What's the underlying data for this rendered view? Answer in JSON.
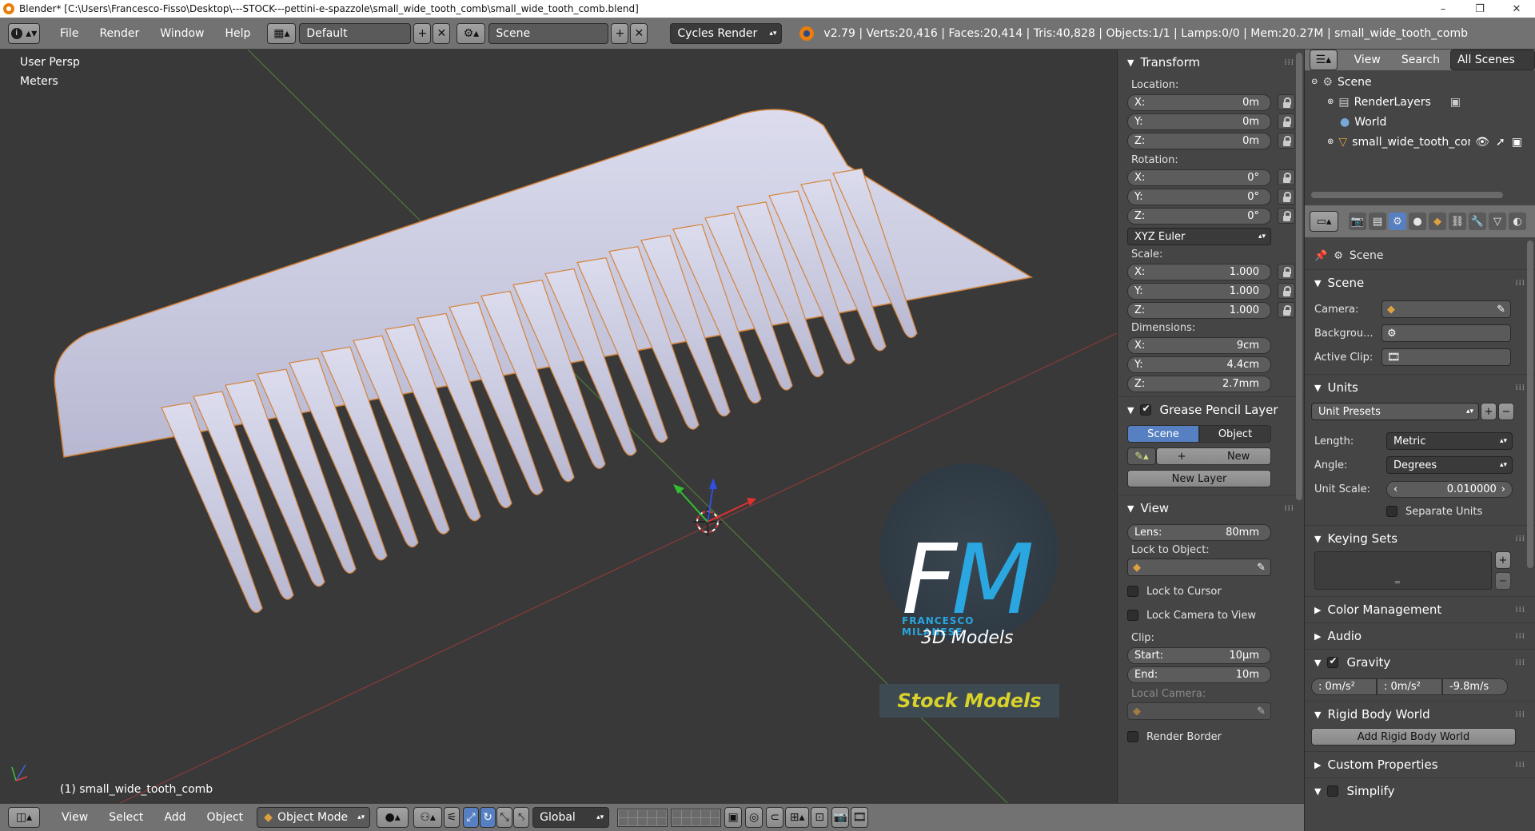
{
  "window": {
    "title": "Blender* [C:\\Users\\Francesco-Fisso\\Desktop\\---STOCK---pettini-e-spazzole\\small_wide_tooth_comb\\small_wide_tooth_comb.blend]",
    "minimize": "–",
    "maximize": "❐",
    "close": "✕"
  },
  "infobar": {
    "menus": [
      "File",
      "Render",
      "Window",
      "Help"
    ],
    "layout": "Default",
    "scene": "Scene",
    "engine": "Cycles Render",
    "stats": "v2.79 | Verts:20,416 | Faces:20,414 | Tris:40,828 | Objects:1/1 | Lamps:0/0 | Mem:20.27M | small_wide_tooth_comb"
  },
  "viewport": {
    "view_label": "User Persp",
    "units_label": "Meters",
    "object_label": "(1) small_wide_tooth_comb",
    "watermark": {
      "big": "FM",
      "name": "FRANCESCO MILANESE",
      "sub": "3D Models",
      "banner": "Stock Models"
    }
  },
  "viewport_header": {
    "menus": [
      "View",
      "Select",
      "Add",
      "Object"
    ],
    "mode": "Object Mode",
    "orientation": "Global"
  },
  "npanel": {
    "transform": {
      "title": "Transform",
      "location_label": "Location:",
      "location": [
        {
          "k": "X:",
          "v": "0m"
        },
        {
          "k": "Y:",
          "v": "0m"
        },
        {
          "k": "Z:",
          "v": "0m"
        }
      ],
      "rotation_label": "Rotation:",
      "rotation": [
        {
          "k": "X:",
          "v": "0°"
        },
        {
          "k": "Y:",
          "v": "0°"
        },
        {
          "k": "Z:",
          "v": "0°"
        }
      ],
      "rotation_mode": "XYZ Euler",
      "scale_label": "Scale:",
      "scale": [
        {
          "k": "X:",
          "v": "1.000"
        },
        {
          "k": "Y:",
          "v": "1.000"
        },
        {
          "k": "Z:",
          "v": "1.000"
        }
      ],
      "dimensions_label": "Dimensions:",
      "dimensions": [
        {
          "k": "X:",
          "v": "9cm"
        },
        {
          "k": "Y:",
          "v": "4.4cm"
        },
        {
          "k": "Z:",
          "v": "2.7mm"
        }
      ]
    },
    "grease_pencil": {
      "title": "Grease Pencil Layer",
      "tab_scene": "Scene",
      "tab_object": "Object",
      "new": "New",
      "new_layer": "New Layer"
    },
    "view": {
      "title": "View",
      "lens_k": "Lens:",
      "lens_v": "80mm",
      "lock_to_object": "Lock to Object:",
      "lock_to_cursor": "Lock to Cursor",
      "lock_camera": "Lock Camera to View",
      "clip_label": "Clip:",
      "clip_start_k": "Start:",
      "clip_start_v": "10µm",
      "clip_end_k": "End:",
      "clip_end_v": "10m",
      "local_camera": "Local Camera:",
      "render_border": "Render Border"
    }
  },
  "outliner": {
    "view": "View",
    "search": "Search",
    "filter": "All Scenes",
    "items": [
      "Scene",
      "RenderLayers",
      "World",
      "small_wide_tooth_com"
    ]
  },
  "properties": {
    "context": "Scene",
    "scene_panel": {
      "title": "Scene",
      "camera": "Camera:",
      "background": "Backgrou...",
      "active_clip": "Active Clip:"
    },
    "units_panel": {
      "title": "Units",
      "presets": "Unit Presets",
      "length_k": "Length:",
      "length_v": "Metric",
      "angle_k": "Angle:",
      "angle_v": "Degrees",
      "scale_k": "Unit Scale:",
      "scale_v": "0.010000",
      "separate": "Separate Units"
    },
    "keying_sets": "Keying Sets",
    "color_management": "Color Management",
    "audio": "Audio",
    "gravity": {
      "title": "Gravity",
      "x": ": 0m/s²",
      "y": ": 0m/s²",
      "z": "-9.8m/s"
    },
    "rigid_body": "Rigid Body World",
    "add_rigid_body": "Add Rigid Body World",
    "custom_properties": "Custom Properties",
    "simplify": "Simplify"
  },
  "colors": {
    "accent_blue": "#5680c2",
    "header_grey": "#727272",
    "panel_grey": "#454545",
    "viewport_bg": "#393939",
    "comb": "#c9c9e0",
    "comb_outline": "#d4833a",
    "watermark_blue": "#2aa6e0",
    "watermark_yellow": "#d8d22a"
  }
}
